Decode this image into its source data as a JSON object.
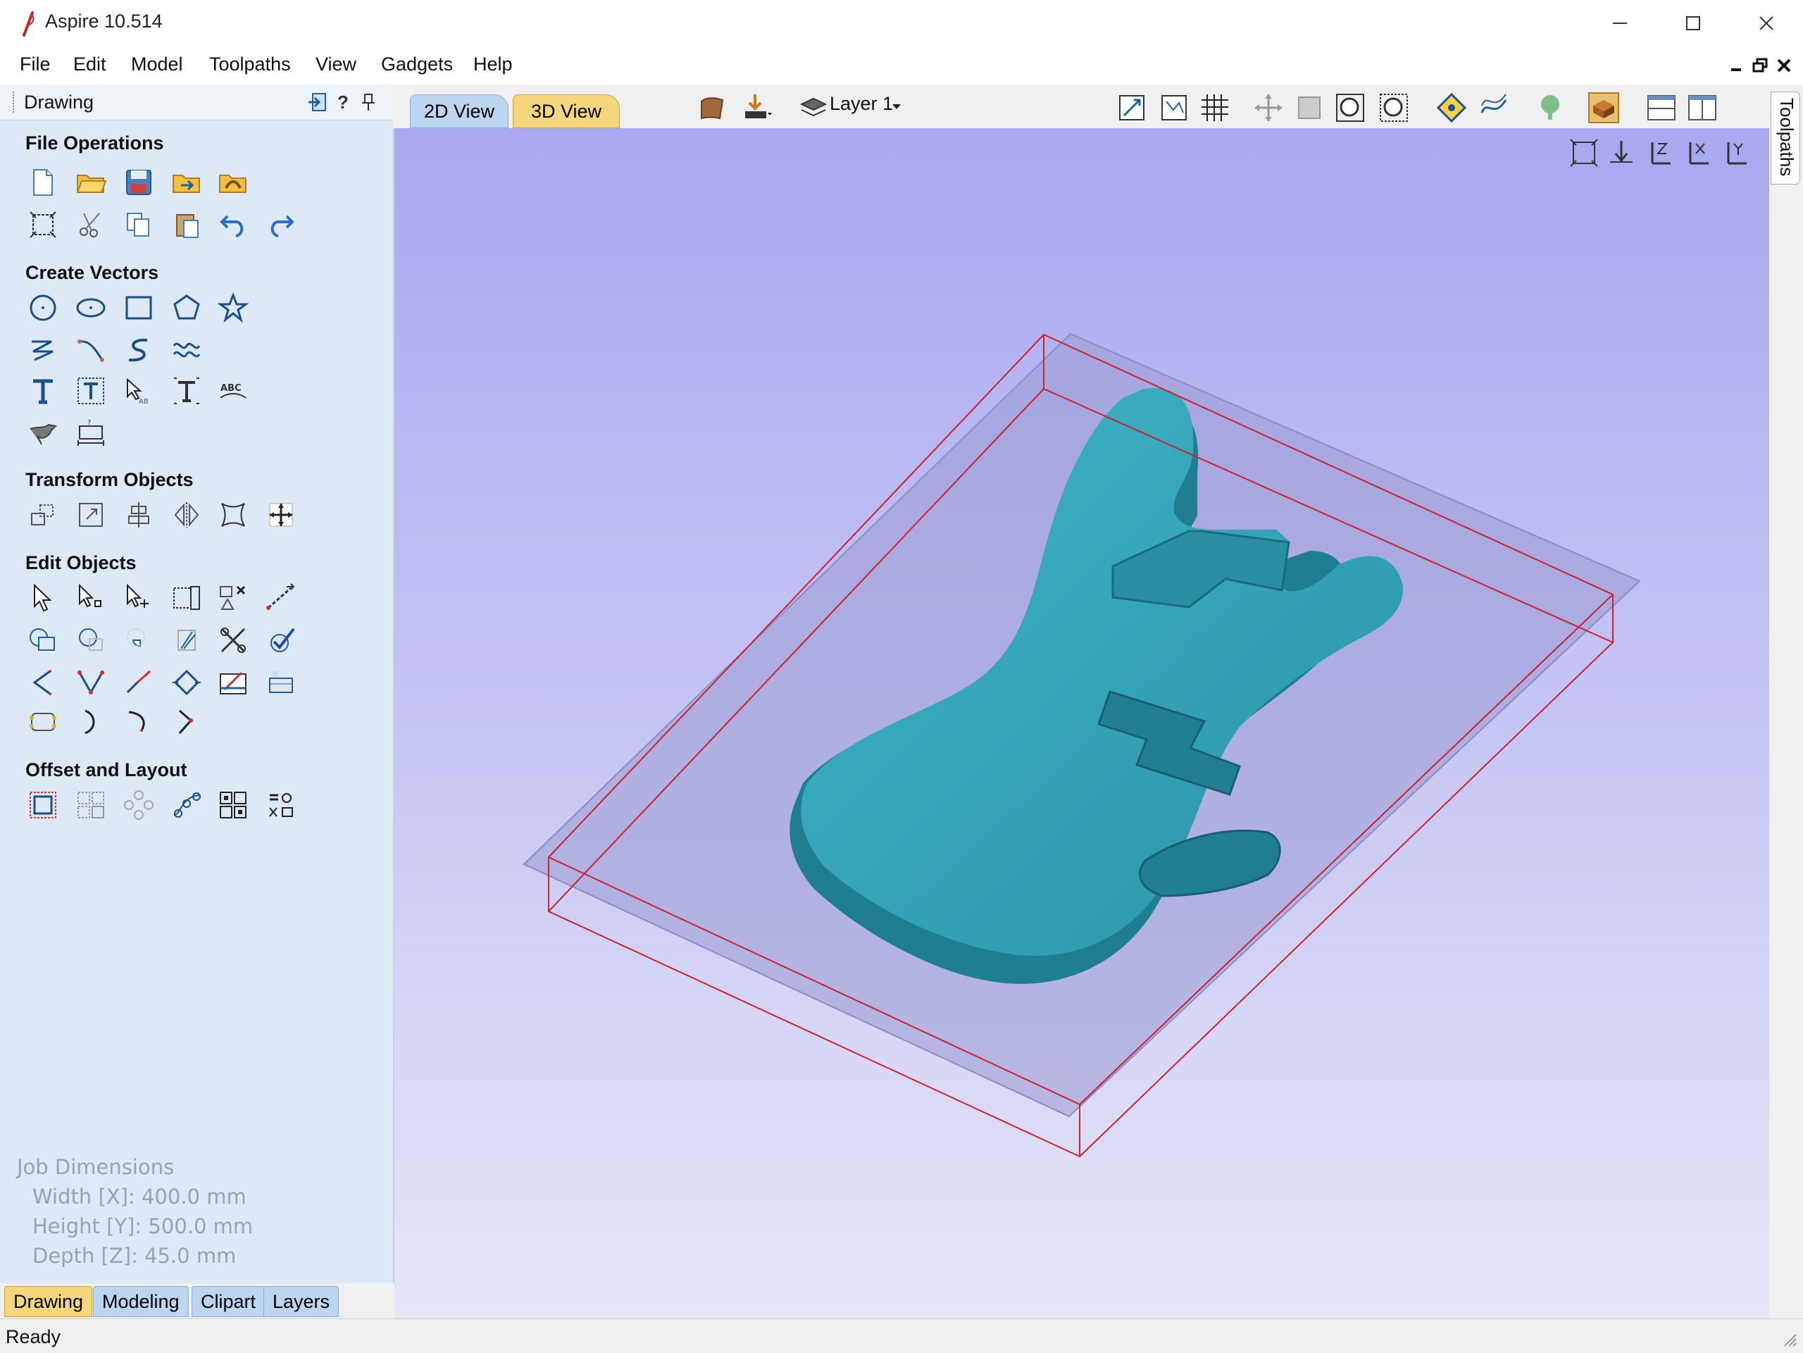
{
  "window": {
    "title": "Aspire 10.514"
  },
  "menu": [
    "File",
    "Edit",
    "Model",
    "Toolpaths",
    "View",
    "Gadgets",
    "Help"
  ],
  "panel": {
    "title": "Drawing",
    "help_label": "?",
    "sections": {
      "file_operations": "File Operations",
      "create_vectors": "Create Vectors",
      "transform_objects": "Transform Objects",
      "edit_objects": "Edit Objects",
      "offset_layout": "Offset and Layout"
    }
  },
  "job_dimensions": {
    "title": "Job Dimensions",
    "width": "Width  [X]: 400.0 mm",
    "height": "Height [Y]: 500.0 mm",
    "depth": "Depth  [Z]: 45.0 mm"
  },
  "bottom_tabs": [
    "Drawing",
    "Modeling",
    "Clipart",
    "Layers"
  ],
  "view_tabs": [
    "2D View",
    "3D View"
  ],
  "layer": {
    "name": "Layer 1"
  },
  "right_dock": {
    "tab": "Toolpaths"
  },
  "status": {
    "text": "Ready"
  },
  "colors": {
    "accent_tab": "#f6d67a",
    "model": "#2f9cb0",
    "boundary": "#cc2233"
  }
}
